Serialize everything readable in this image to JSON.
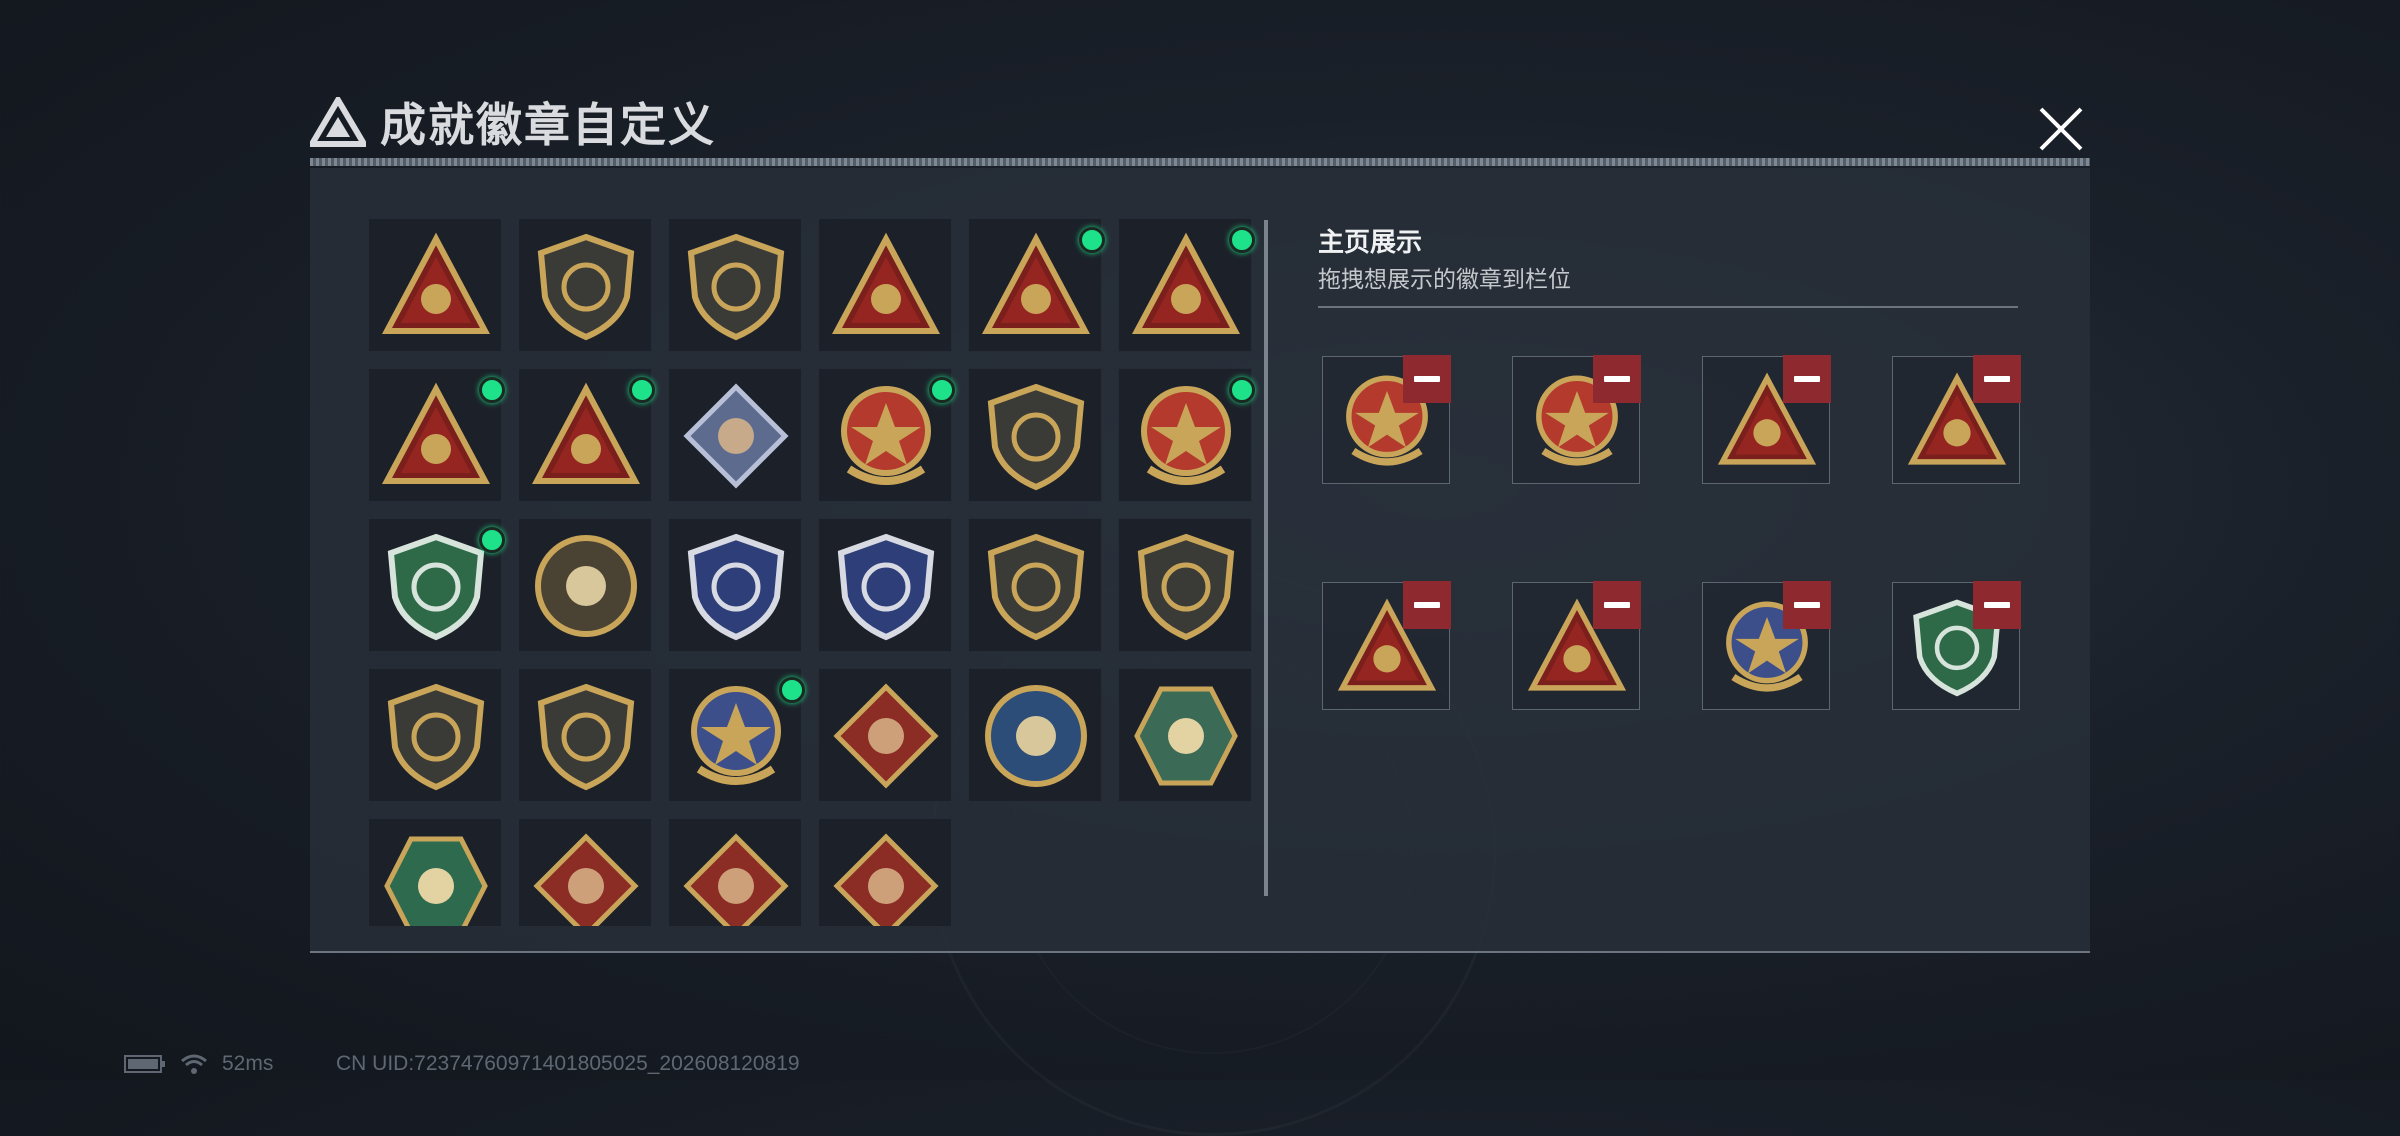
{
  "header": {
    "title": "成就徽章自定义"
  },
  "colors": {
    "accent_dot": "#1de28a",
    "remove": "#8e2a2f",
    "panel": "#282f39"
  },
  "collection": {
    "badges": [
      {
        "icon": "triangle-logo-shield-badge",
        "new": false
      },
      {
        "icon": "helicopter-shield-badge",
        "new": false
      },
      {
        "icon": "dagger-shield-badge",
        "new": false
      },
      {
        "icon": "hand-sign-triangle-badge",
        "new": false
      },
      {
        "icon": "hat-triangle-badge",
        "new": true
      },
      {
        "icon": "number-one-triangle-badge",
        "new": true
      },
      {
        "icon": "usb-triangle-badge",
        "new": true
      },
      {
        "icon": "soldiers-triangle-badge",
        "new": true
      },
      {
        "icon": "rose-diamond-badge",
        "new": false
      },
      {
        "icon": "star-medal-badge",
        "new": true
      },
      {
        "icon": "eagle-shield-badge",
        "new": false
      },
      {
        "icon": "ribbon-crest-badge",
        "new": true
      },
      {
        "icon": "green-gem-shield-badge",
        "new": true
      },
      {
        "icon": "skull-round-badge",
        "new": false
      },
      {
        "icon": "rifle-crosshair-blue-badge",
        "new": false
      },
      {
        "icon": "rifle-crosshair-blue-badge-2",
        "new": false
      },
      {
        "icon": "knife-shield-badge",
        "new": false
      },
      {
        "icon": "smg-shield-badge",
        "new": false
      },
      {
        "icon": "sniper-shield-badge",
        "new": false
      },
      {
        "icon": "pistol-shield-badge",
        "new": false
      },
      {
        "icon": "wings-crest-badge",
        "new": true
      },
      {
        "icon": "wolf-diamond-badge",
        "new": false
      },
      {
        "icon": "eagle-round-badge",
        "new": false
      },
      {
        "icon": "hornet-hex-badge",
        "new": false
      },
      {
        "icon": "gun-hex-green-badge",
        "new": false
      },
      {
        "icon": "dragon-diamond-badge",
        "new": false
      },
      {
        "icon": "dragon-diamond-badge-2",
        "new": false
      },
      {
        "icon": "runner-diamond-badge",
        "new": false
      }
    ]
  },
  "showcase": {
    "title": "主页展示",
    "subtitle": "拖拽想展示的徽章到栏位",
    "slots": [
      {
        "icon": "star-medal-badge"
      },
      {
        "icon": "ribbon-crest-badge"
      },
      {
        "icon": "usb-triangle-badge"
      },
      {
        "icon": "soldiers-triangle-badge"
      },
      {
        "icon": "hat-triangle-badge"
      },
      {
        "icon": "number-one-triangle-badge"
      },
      {
        "icon": "wings-crest-badge"
      },
      {
        "icon": "green-gem-shield-badge"
      }
    ]
  },
  "status_bar": {
    "ping": "52ms",
    "uid": "CN UID:7237476097140180502​5_202608120819"
  }
}
